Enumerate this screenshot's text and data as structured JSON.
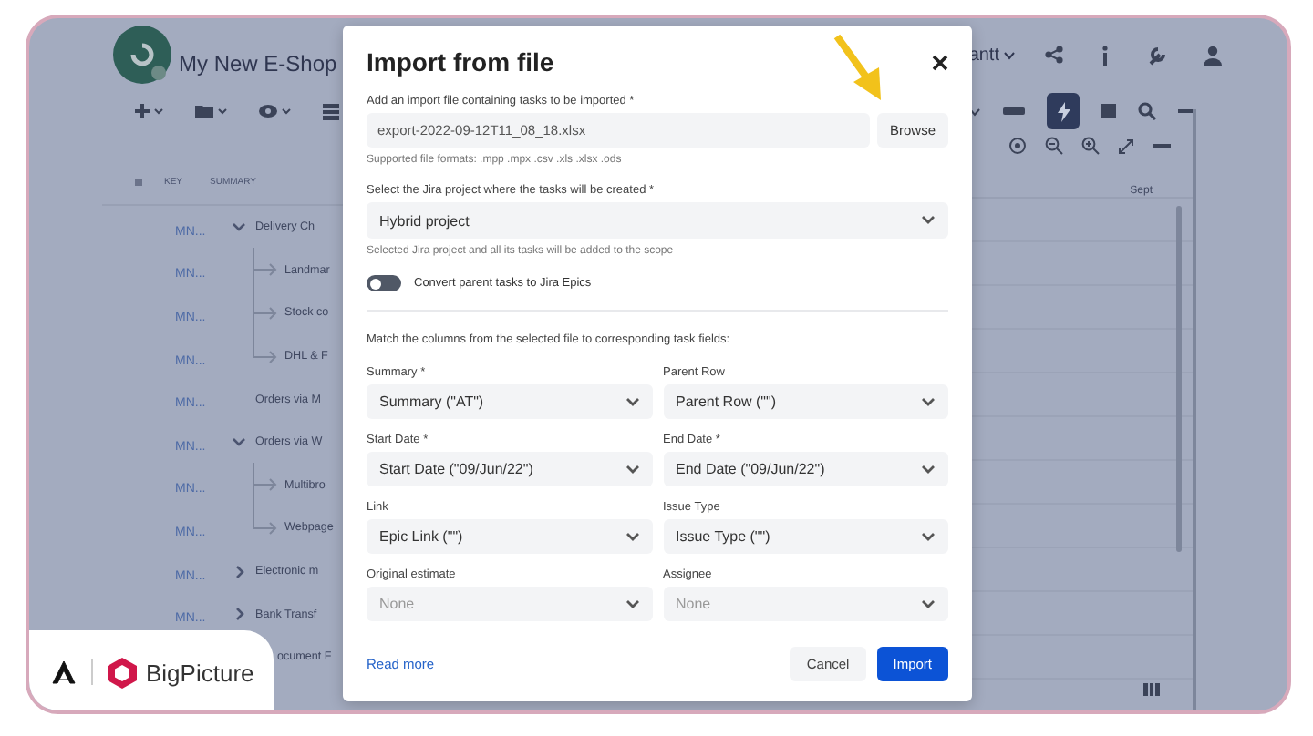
{
  "app": {
    "title": "My New E-Shop",
    "project_menu": "antt",
    "columns": [
      "KEY",
      "SUMMARY"
    ],
    "timeline_label": "Sept",
    "rows": [
      {
        "key": "MN...",
        "summary": "Delivery Ch",
        "kind": "group",
        "expanded": true,
        "children": [
          {
            "key": "MN...",
            "summary": "Landmar",
            "kind": "item"
          },
          {
            "key": "MN...",
            "summary": "Stock co",
            "kind": "item"
          },
          {
            "key": "MN...",
            "summary": "DHL & F",
            "kind": "item"
          }
        ]
      },
      {
        "key": "MN...",
        "summary": "Orders via M",
        "kind": "item"
      },
      {
        "key": "MN...",
        "summary": "Orders via W",
        "kind": "group",
        "expanded": true,
        "children": [
          {
            "key": "MN...",
            "summary": "Multibro",
            "kind": "item"
          },
          {
            "key": "MN...",
            "summary": "Webpage",
            "kind": "item"
          }
        ]
      },
      {
        "key": "MN...",
        "summary": "Electronic m",
        "kind": "group",
        "expanded": false
      },
      {
        "key": "MN...",
        "summary": "Bank Transf",
        "kind": "group",
        "expanded": false
      },
      {
        "summary": "ocument F",
        "kind": "item"
      }
    ]
  },
  "dialog": {
    "title": "Import from file",
    "file": {
      "label": "Add an import file containing tasks to be imported *",
      "value": "export-2022-09-12T11_08_18.xlsx",
      "button": "Browse",
      "hint": "Supported file formats: .mpp .mpx .csv .xls .xlsx .ods"
    },
    "project": {
      "label": "Select the Jira project where the tasks will be created *",
      "value": "Hybrid project",
      "hint": "Selected Jira project and all its tasks will be added to the scope"
    },
    "toggle": {
      "label": "Convert parent tasks to Jira Epics",
      "on": false
    },
    "mapping_intro": "Match the columns from the selected file to corresponding task fields:",
    "fields": [
      {
        "label": "Summary *",
        "value": "Summary (\"AT\")"
      },
      {
        "label": "Parent Row",
        "value": "Parent Row (\"\")"
      },
      {
        "label": "Start Date *",
        "value": "Start Date (\"09/Jun/22\")"
      },
      {
        "label": "End Date *",
        "value": "End Date (\"09/Jun/22\")"
      },
      {
        "label": "Link",
        "value": "Epic Link (\"\")"
      },
      {
        "label": "Issue Type",
        "value": "Issue Type (\"\")"
      },
      {
        "label": "Original estimate",
        "placeholder": "None"
      },
      {
        "label": "Assignee",
        "placeholder": "None"
      }
    ],
    "link": "Read more",
    "buttons": [
      {
        "label": "Cancel",
        "kind": "subtle"
      },
      {
        "label": "Import",
        "kind": "primary"
      }
    ]
  },
  "badge": {
    "brand": "BigPicture"
  }
}
